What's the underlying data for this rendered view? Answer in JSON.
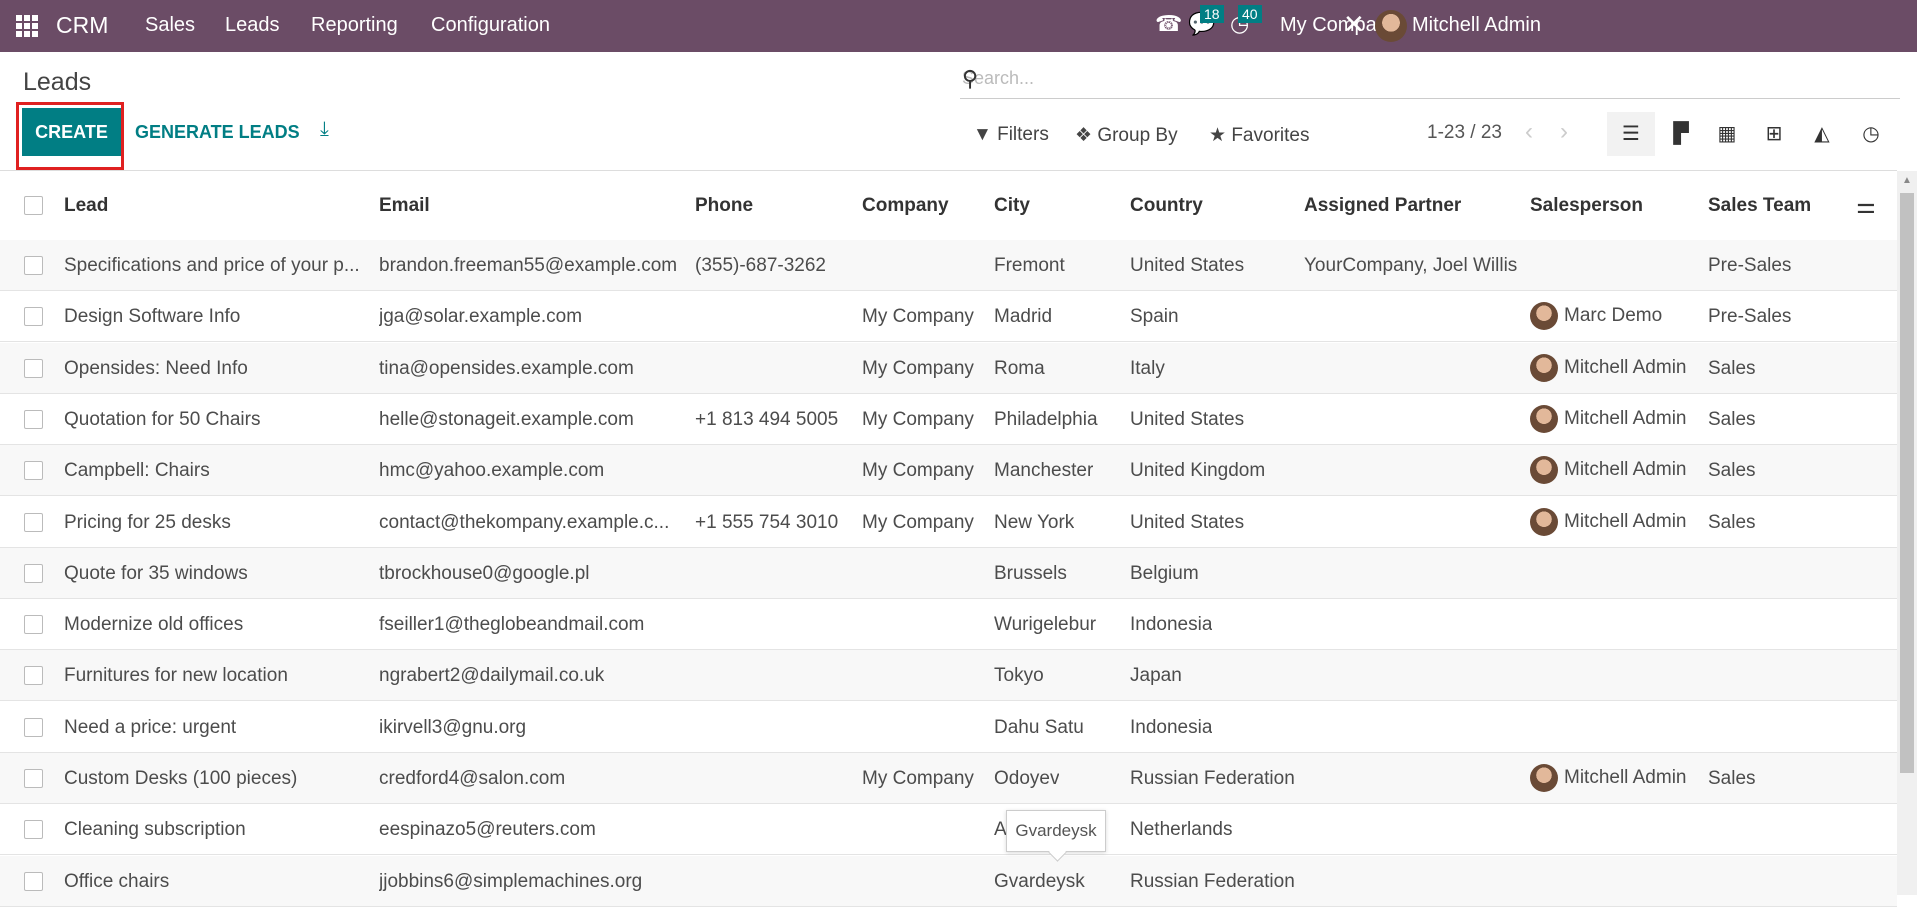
{
  "navbar": {
    "app": "CRM",
    "menus": [
      "Sales",
      "Leads",
      "Reporting",
      "Configuration"
    ],
    "messages_count": "18",
    "activities_count": "40",
    "company": "My Company",
    "user": "Mitchell Admin"
  },
  "page": {
    "title": "Leads",
    "create": "CREATE",
    "generate": "GENERATE LEADS"
  },
  "search": {
    "placeholder": "Search..."
  },
  "controls": {
    "filters": "Filters",
    "group_by": "Group By",
    "favorites": "Favorites",
    "pager": "1-23 / 23"
  },
  "colors": {
    "navbar": "#6b4c66",
    "primary": "#017e84",
    "highlight": "#e02020"
  },
  "columns": [
    "Lead",
    "Email",
    "Phone",
    "Company",
    "City",
    "Country",
    "Assigned Partner",
    "Salesperson",
    "Sales Team"
  ],
  "rows": [
    [
      "Specifications and price of your p...",
      "brandon.freeman55@example.com",
      "(355)-687-3262",
      "",
      "Fremont",
      "United States",
      "YourCompany, Joel Willis",
      "",
      "Pre-Sales"
    ],
    [
      "Design Software Info",
      "jga@solar.example.com",
      "",
      "My Company",
      "Madrid",
      "Spain",
      "",
      "Marc Demo",
      "Pre-Sales"
    ],
    [
      "Opensides: Need Info",
      "tina@opensides.example.com",
      "",
      "My Company",
      "Roma",
      "Italy",
      "",
      "Mitchell Admin",
      "Sales"
    ],
    [
      "Quotation for 50 Chairs",
      "helle@stonageit.example.com",
      "+1 813 494 5005",
      "My Company",
      "Philadelphia",
      "United States",
      "",
      "Mitchell Admin",
      "Sales"
    ],
    [
      "Campbell: Chairs",
      "hmc@yahoo.example.com",
      "",
      "My Company",
      "Manchester",
      "United Kingdom",
      "",
      "Mitchell Admin",
      "Sales"
    ],
    [
      "Pricing for 25 desks",
      "contact@thekompany.example.c...",
      "+1 555 754 3010",
      "My Company",
      "New York",
      "United States",
      "",
      "Mitchell Admin",
      "Sales"
    ],
    [
      "Quote for 35 windows",
      "tbrockhouse0@google.pl",
      "",
      "",
      "Brussels",
      "Belgium",
      "",
      "",
      ""
    ],
    [
      "Modernize old offices",
      "fseiller1@theglobeandmail.com",
      "",
      "",
      "Wurigelebur",
      "Indonesia",
      "",
      "",
      ""
    ],
    [
      "Furnitures for new location",
      "ngrabert2@dailymail.co.uk",
      "",
      "",
      "Tokyo",
      "Japan",
      "",
      "",
      ""
    ],
    [
      "Need a price: urgent",
      "ikirvell3@gnu.org",
      "",
      "",
      "Dahu Satu",
      "Indonesia",
      "",
      "",
      ""
    ],
    [
      "Custom Desks (100 pieces)",
      "credford4@salon.com",
      "",
      "My Company",
      "Odoyev",
      "Russian Federation",
      "",
      "Mitchell Admin",
      "Sales"
    ],
    [
      "Cleaning subscription",
      "eespinazo5@reuters.com",
      "",
      "",
      "Amsterdam",
      "Netherlands",
      "",
      "",
      ""
    ],
    [
      "Office chairs",
      "jjobbins6@simplemachines.org",
      "",
      "",
      "Gvardeysk",
      "Russian Federation",
      "",
      "",
      ""
    ]
  ],
  "tooltip": "Gvardeysk"
}
